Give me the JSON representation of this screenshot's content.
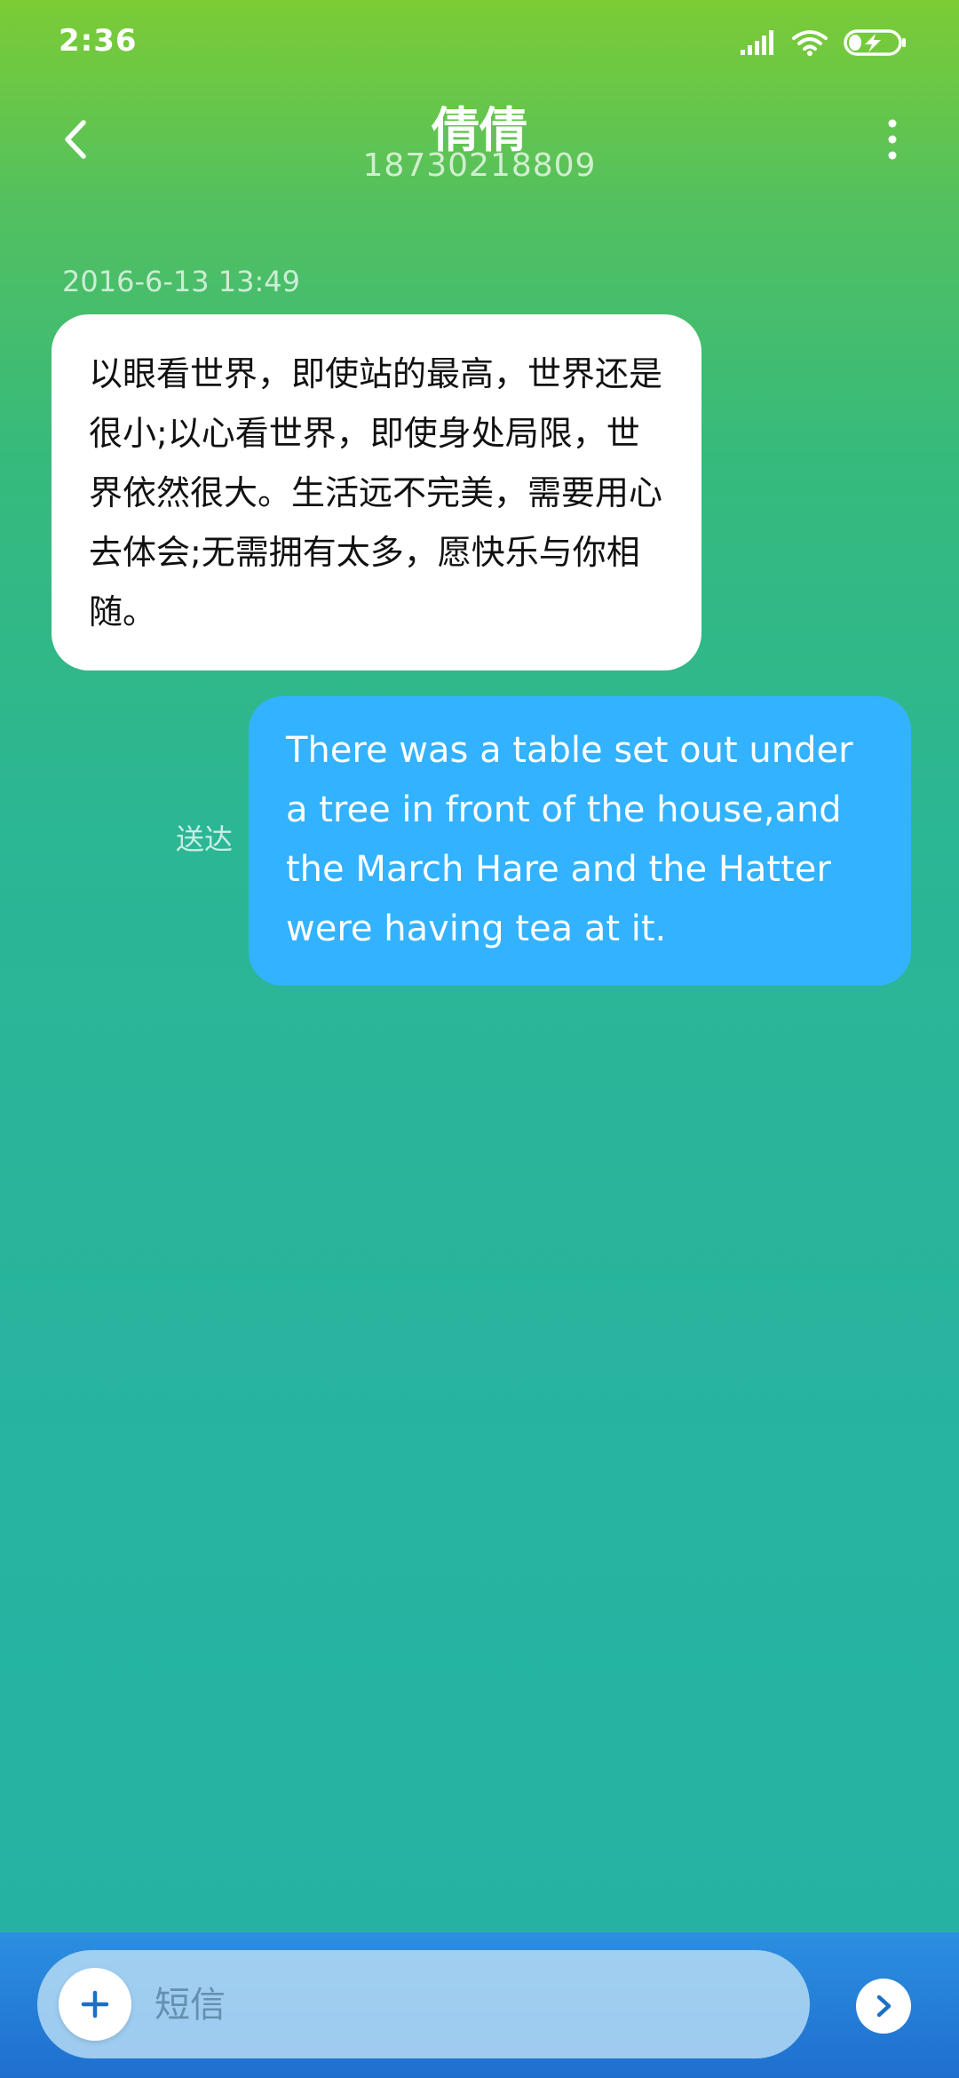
{
  "status_bar": {
    "time": "2:36",
    "icons": [
      "signal-icon",
      "wifi-icon",
      "battery-charging-icon"
    ]
  },
  "header": {
    "back_icon": "chevron-left-icon",
    "contact_name": "倩倩",
    "contact_number": "18730218809",
    "more_icon": "more-vertical-icon"
  },
  "messages": [
    {
      "direction": "incoming",
      "timestamp": "2016-6-13 13:49",
      "text": "以眼看世界，即使站的最高，世界还是很小;以心看世界，即使身处局限，世界依然很大。生活远不完美，需要用心去体会;无需拥有太多，愿快乐与你相随。"
    },
    {
      "direction": "outgoing",
      "status": "送达",
      "text": "There was a table set out under a tree in front of the house,and the March Hare and the Hatter were having tea at it."
    }
  ],
  "composer": {
    "add_icon": "plus-icon",
    "placeholder": "短信",
    "value": "",
    "send_icon": "send-arrow-icon"
  },
  "colors": {
    "incoming_bubble": "#ffffff",
    "outgoing_bubble": "#33b2ff",
    "composer_bar": "#2280d8"
  }
}
